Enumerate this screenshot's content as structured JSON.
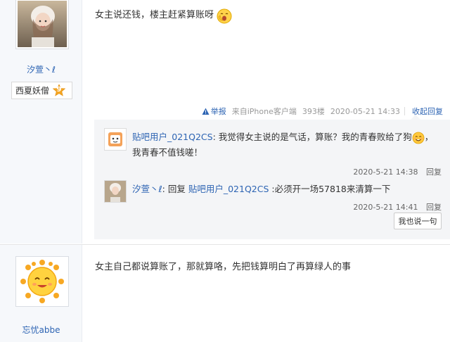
{
  "post1": {
    "username": "汐萱丶ℓ",
    "badge": {
      "name": "西夏妖僧",
      "level": "9"
    },
    "content": "女主说还钱，楼主赶紧算账呀",
    "tail": {
      "report": "举报",
      "source": "来自iPhone客户端",
      "floor": "393楼",
      "time": "2020-05-21 14:33",
      "toggle": "收起回复"
    },
    "replies": [
      {
        "user": "贴吧用户_021Q2CS",
        "text_before": ": 我觉得女主说的是气话，算账？我的青春败给了狗",
        "text_after": "，我青春不值钱嗟！",
        "time": "2020-5-21 14:38",
        "reply_label": "回复"
      },
      {
        "user": "汐萱丶ℓ",
        "prefix": ": 回复",
        "target": "贴吧用户_021Q2CS",
        "text": " :必须开一场57818来清算一下",
        "time": "2020-5-21 14:41",
        "reply_label": "回复"
      }
    ],
    "say_button": "我也说一句"
  },
  "post2": {
    "username": "忘忧abbe",
    "content": "女主自己都说算账了，那就算咯，先把钱算明白了再算绿人的事"
  },
  "colors": {
    "link": "#2d64b3",
    "left_column": "#f6f8fb",
    "reply_box": "#f4f5f7",
    "level_badge": "#f5a623"
  },
  "icons": [
    "report-icon",
    "level-star-icon",
    "yawn-emoji-icon",
    "smile-emoji-icon",
    "sun-avatar-icon"
  ]
}
